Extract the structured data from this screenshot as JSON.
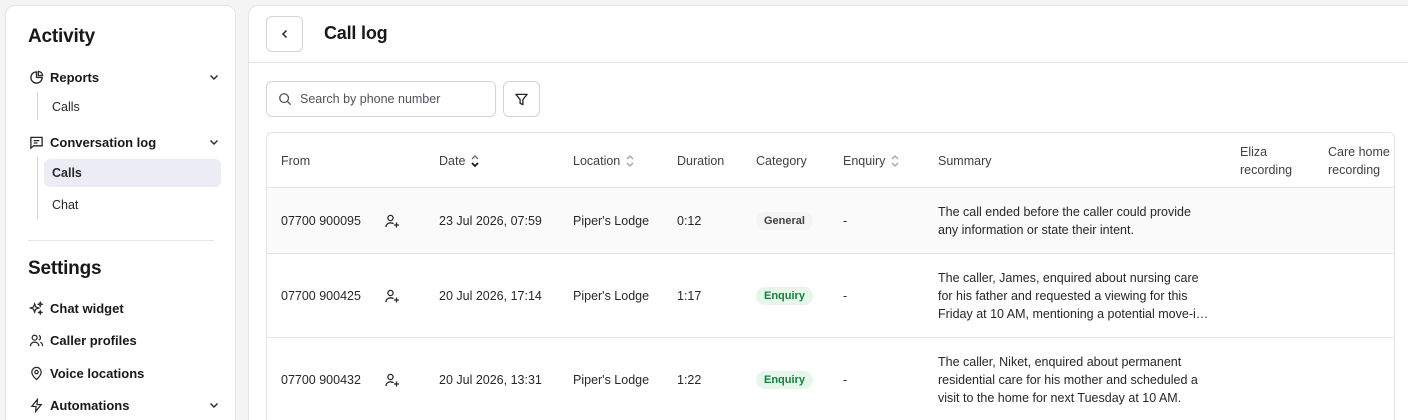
{
  "sidebar": {
    "activity_heading": "Activity",
    "reports_label": "Reports",
    "reports_sub": [
      "Calls"
    ],
    "conversation_label": "Conversation log",
    "conversation_sub": [
      "Calls",
      "Chat"
    ],
    "settings_heading": "Settings",
    "settings_items": [
      "Chat widget",
      "Caller profiles",
      "Voice locations",
      "Automations"
    ]
  },
  "header": {
    "title": "Call log"
  },
  "search": {
    "placeholder": "Search by phone number",
    "value": ""
  },
  "table": {
    "columns": [
      "From",
      "Date",
      "Location",
      "Duration",
      "Category",
      "Enquiry",
      "Summary",
      "Eliza recording",
      "Care home recording"
    ],
    "rows": [
      {
        "from": "07700 900095",
        "date": "23 Jul 2026, 07:59",
        "location": "Piper's Lodge",
        "duration": "0:12",
        "category": "General",
        "enquiry": "-",
        "summary": "The call ended before the caller could provide any information or state their intent."
      },
      {
        "from": "07700 900425",
        "date": "20 Jul 2026, 17:14",
        "location": "Piper's Lodge",
        "duration": "1:17",
        "category": "Enquiry",
        "enquiry": "-",
        "summary": "The caller, James, enquired about nursing care for his father and requested a viewing for this Friday at 10 AM, mentioning a potential move-in date in the near future."
      },
      {
        "from": "07700 900432",
        "date": "20 Jul 2026, 13:31",
        "location": "Piper's Lodge",
        "duration": "1:22",
        "category": "Enquiry",
        "enquiry": "-",
        "summary": "The caller, Niket, enquired about permanent residential care for his mother and scheduled a visit to the home for next Tuesday at 10 AM."
      }
    ]
  },
  "colors": {
    "active_bg": "#ececf5",
    "enquiry_badge_bg": "#e6f6ea",
    "enquiry_badge_fg": "#15803d"
  }
}
